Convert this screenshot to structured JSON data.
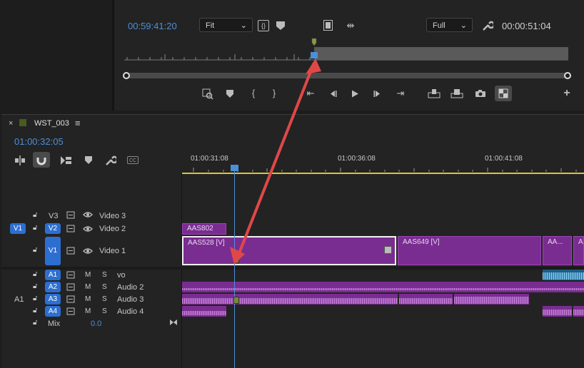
{
  "monitor": {
    "timecode_left": "00:59:41:20",
    "fit_label": "Fit",
    "full_label": "Full",
    "timecode_right": "00:00:51:04"
  },
  "timeline": {
    "close_x": "×",
    "sequence_name": "WST_003",
    "menu_icon": "≡",
    "current_timecode": "01:00:32:05",
    "ruler_labels": [
      "01:00:31:08",
      "01:00:36:08",
      "01:00:41:08"
    ],
    "tracks_video": [
      {
        "name": "V3",
        "label": "Video 3",
        "source": ""
      },
      {
        "name": "V2",
        "label": "Video 2",
        "source": "V1"
      },
      {
        "name": "V1",
        "label": "Video 1",
        "source": ""
      }
    ],
    "tracks_audio": [
      {
        "name": "A1",
        "label": "vo",
        "source": ""
      },
      {
        "name": "A2",
        "label": "Audio 2",
        "source": ""
      },
      {
        "name": "A3",
        "label": "Audio 3",
        "source": "A1"
      },
      {
        "name": "A4",
        "label": "Audio 4",
        "source": ""
      }
    ],
    "mute_label": "M",
    "solo_label": "S",
    "mix_label": "Mix",
    "mix_value": "0.0",
    "clips": {
      "v2_clip": "AAS802",
      "v1_clip1": "AAS528 [V]",
      "v1_clip2": "AAS649 [V]",
      "v1_clip3": "AA...",
      "v1_clip4": "A..."
    }
  },
  "colors": {
    "accent_blue": "#2d6fd1",
    "clip_purple": "#7a2d91",
    "annotation_red": "#e04848",
    "playhead_blue": "#4a90d9"
  },
  "icons": [
    "wrench-icon",
    "marker-icon",
    "camera-icon",
    "step-back-icon",
    "play-icon",
    "step-forward-icon",
    "snap-icon",
    "linked-selection-icon",
    "captions-icon"
  ]
}
